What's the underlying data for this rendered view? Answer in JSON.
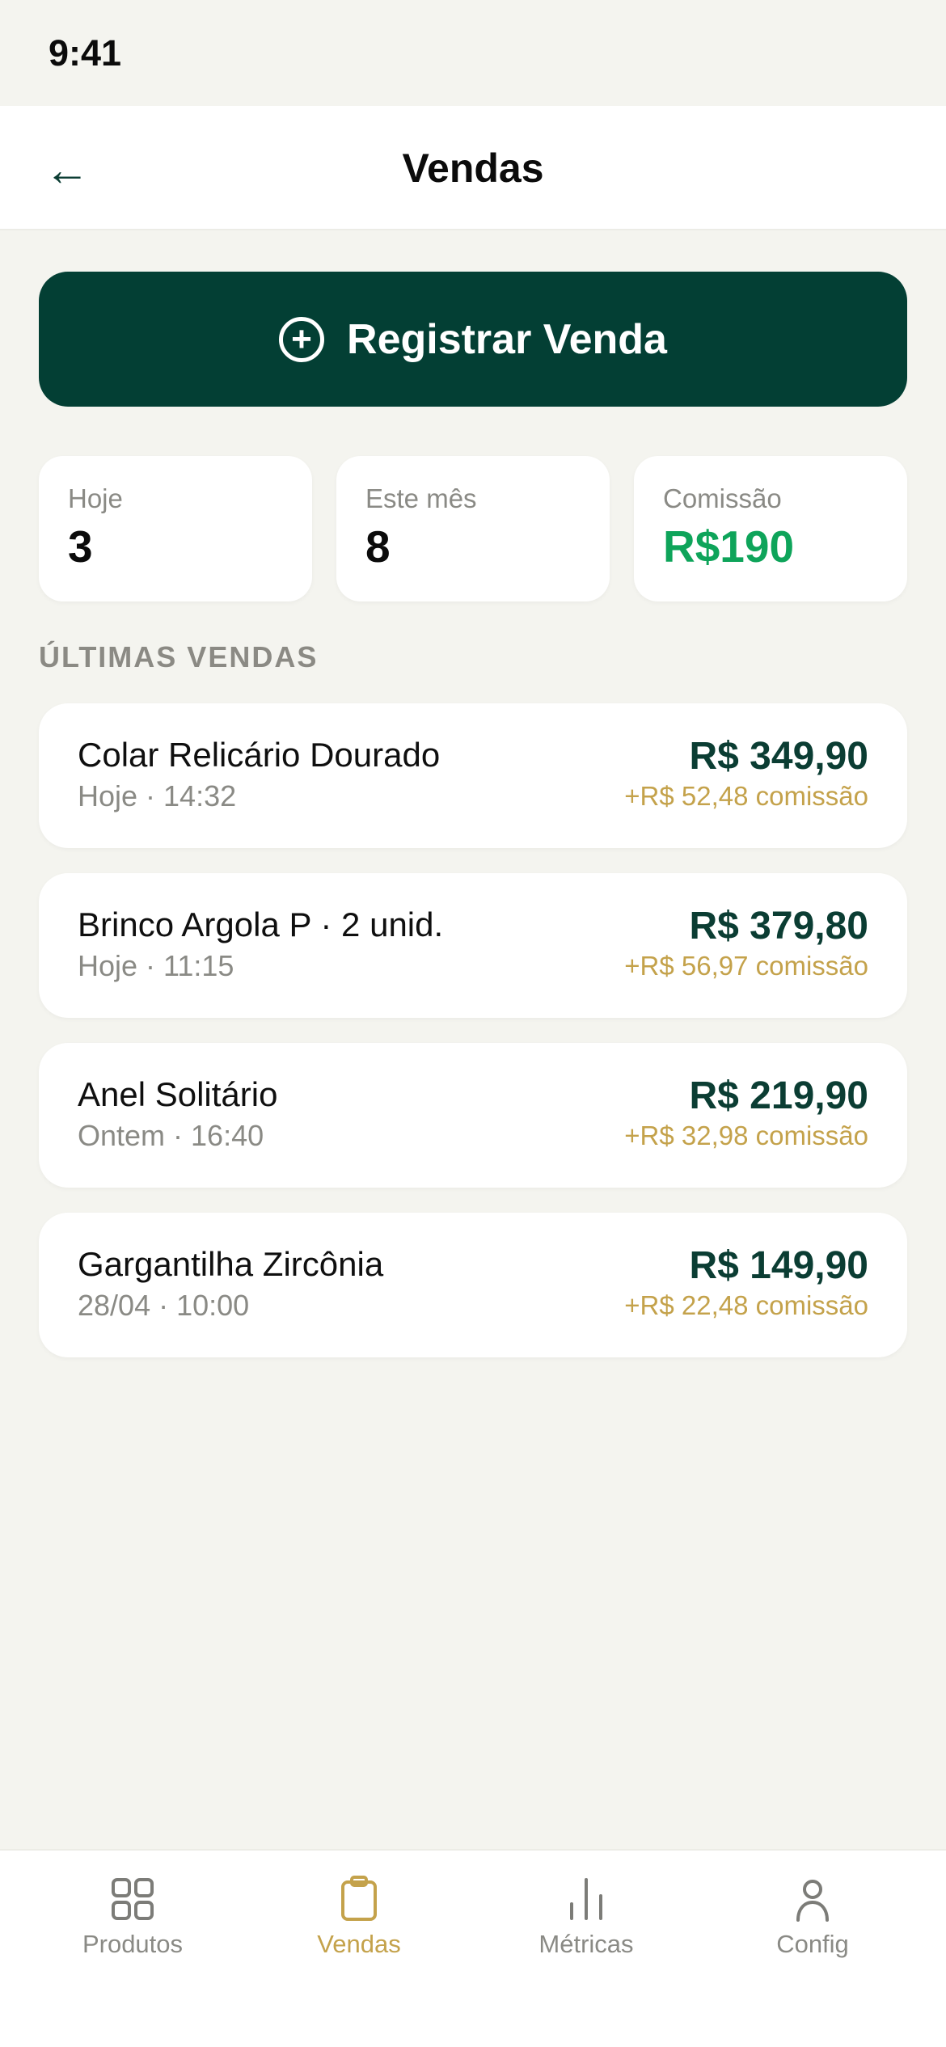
{
  "status_bar": {
    "time": "9:41"
  },
  "header": {
    "back_icon": "arrow-left-icon",
    "title": "Vendas"
  },
  "primary_action": {
    "label": "Registrar Venda",
    "icon": "plus-circle-icon"
  },
  "stats": [
    {
      "label": "Hoje",
      "value": "3"
    },
    {
      "label": "Este mês",
      "value": "8"
    },
    {
      "label": "Comissão",
      "value": "R$190",
      "color": "#0ea45a"
    }
  ],
  "recent_sales": {
    "title": "ÚLTIMAS VENDAS",
    "items": [
      {
        "name": "Colar Relicário Dourado",
        "date": "Hoje · 14:32",
        "value": "R$ 349,90",
        "commission": "+R$ 52,48 comissão"
      },
      {
        "name": "Brinco Argola P · 2 unid.",
        "date": "Hoje · 11:15",
        "value": "R$ 379,80",
        "commission": "+R$ 56,97 comissão"
      },
      {
        "name": "Anel Solitário",
        "date": "Ontem · 16:40",
        "value": "R$ 219,90",
        "commission": "+R$ 32,98 comissão"
      },
      {
        "name": "Gargantilha Zircônia",
        "date": "28/04 · 10:00",
        "value": "R$ 149,90",
        "commission": "+R$ 22,48 comissão"
      }
    ]
  },
  "tabbar": {
    "tabs": [
      {
        "label": "Produtos",
        "icon": "grid-icon",
        "active": false
      },
      {
        "label": "Vendas",
        "icon": "clipboard-icon",
        "active": true
      },
      {
        "label": "Métricas",
        "icon": "bar-chart-icon",
        "active": false
      },
      {
        "label": "Config",
        "icon": "user-icon",
        "active": false
      }
    ]
  },
  "colors": {
    "primary": "#033f34",
    "accent_gold": "#c4a24b",
    "success_green": "#0ea45a",
    "background": "#f4f4ef"
  }
}
